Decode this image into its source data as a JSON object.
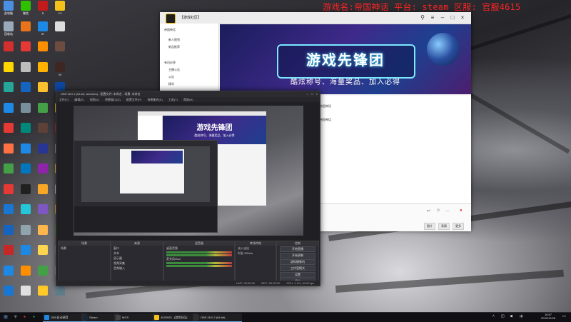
{
  "ticker": "游戏名:帝国神话 平台: steam 区服: 官服4615",
  "colors": {
    "ticker": "#ff2424",
    "accent": "#6aa8e8",
    "obs_bg": "#1f1f24",
    "banner_cyan": "#7be8ff"
  },
  "desktop_icons": [
    {
      "label": "此电脑",
      "color": "#4a90e2"
    },
    {
      "label": "微信",
      "color": "#2dc100"
    },
    {
      "label": "S",
      "color": "#c21b1b"
    },
    {
      "label": "YY",
      "color": "#f4c21b"
    },
    {
      "label": "回收站",
      "color": "#9ab"
    },
    {
      "label": "",
      "color": "#e8731a"
    },
    {
      "label": "IE",
      "color": "#1e88e5"
    },
    {
      "label": "",
      "color": "#ddd"
    },
    {
      "label": "",
      "color": "#d32f2f"
    },
    {
      "label": "",
      "color": "#e53935"
    },
    {
      "label": "",
      "color": "#ff8f00"
    },
    {
      "label": "",
      "color": "#6d4c41"
    },
    {
      "label": "",
      "color": "#ffd600"
    },
    {
      "label": "",
      "color": "#bdbdbd"
    },
    {
      "label": "",
      "color": "#ffb300"
    },
    {
      "label": "M",
      "color": "#3e2723"
    },
    {
      "label": "",
      "color": "#26a69a"
    },
    {
      "label": "",
      "color": "#1565c0"
    },
    {
      "label": "",
      "color": "#fbc02d"
    },
    {
      "label": "",
      "color": "#0d47a1"
    },
    {
      "label": "",
      "color": "#1e88e5"
    },
    {
      "label": "",
      "color": "#78909c"
    },
    {
      "label": "",
      "color": "#43a047"
    },
    {
      "label": "",
      "color": "#ffca28"
    },
    {
      "label": "",
      "color": "#e53935"
    },
    {
      "label": "",
      "color": "#00897b"
    },
    {
      "label": "",
      "color": "#5d4037"
    },
    {
      "label": "",
      "color": "#c62828"
    },
    {
      "label": "",
      "color": "#ff7043"
    },
    {
      "label": "",
      "color": "#1e88e5"
    },
    {
      "label": "",
      "color": "#283593"
    },
    {
      "label": "",
      "color": "#9e9e9e"
    },
    {
      "label": "",
      "color": "#43a047"
    },
    {
      "label": "",
      "color": "#0277bd"
    },
    {
      "label": "",
      "color": "#8e24aa"
    },
    {
      "label": "",
      "color": "#fdd835"
    },
    {
      "label": "",
      "color": "#e53935"
    },
    {
      "label": "",
      "color": "#212121"
    },
    {
      "label": "",
      "color": "#f9a825"
    },
    {
      "label": "",
      "color": "#cfd8dc"
    },
    {
      "label": "",
      "color": "#1976d2"
    },
    {
      "label": "",
      "color": "#26c6da"
    },
    {
      "label": "",
      "color": "#7e57c2"
    },
    {
      "label": "",
      "color": "#fbc02d"
    },
    {
      "label": "",
      "color": "#1565c0"
    },
    {
      "label": "",
      "color": "#90a4ae"
    },
    {
      "label": "",
      "color": "#ffb74d"
    },
    {
      "label": "",
      "color": "#43a047"
    },
    {
      "label": "",
      "color": "#c62828"
    },
    {
      "label": "",
      "color": "#1e88e5"
    },
    {
      "label": "",
      "color": "#ffd54f"
    },
    {
      "label": "",
      "color": "#78909c"
    },
    {
      "label": "",
      "color": "#1e88e5"
    },
    {
      "label": "",
      "color": "#ff8f00"
    },
    {
      "label": "",
      "color": "#43a047"
    },
    {
      "label": "",
      "color": "#9e9e9e"
    },
    {
      "label": "",
      "color": "#1976d2"
    },
    {
      "label": "",
      "color": "#e0e0e0"
    },
    {
      "label": "",
      "color": "#ffca28"
    },
    {
      "label": "",
      "color": "#607d8b"
    }
  ],
  "chat": {
    "title": "【游戏社区】",
    "banner_title": "游戏先锋团",
    "banner_sub": "酷炫称号、海量奖品、加入必得",
    "side_items": [
      "帝国神话",
      "新人报到",
      "新品推荐",
      "有问必答",
      "主播公告",
      "公告",
      "精华"
    ],
    "lines": [
      "帝国神话",
      "帝国神话"
    ],
    "footer_items": [
      "图片",
      "表情",
      "更多"
    ]
  },
  "obs": {
    "title": "OBS 28.0.2 (64-bit, windows) - 配置文件: 未命名 - 场景: 未命名",
    "menu": [
      "文件(F)",
      "编辑(E)",
      "视图(V)",
      "停靠窗口(D)",
      "配置文件(P)",
      "场景集合(S)",
      "工具(T)",
      "帮助(H)"
    ],
    "mini_banner": "游戏先锋团",
    "mini_sub": "酷炫称号、海量奖品、加入必得",
    "docks": {
      "scenes": {
        "title": "场景",
        "items": [
          "场景"
        ]
      },
      "sources": {
        "title": "来源",
        "items": [
          "窗口",
          "文本",
          "显示器",
          "视频采集",
          "音频输入"
        ]
      },
      "mixer": {
        "title": "混音器",
        "items": [
          "桌面音频",
          "麦克风/Aux"
        ]
      },
      "transitions": {
        "title": "转场特效",
        "items": [
          "淡入淡出",
          "时长 300ms"
        ]
      },
      "controls": {
        "title": "控制",
        "buttons": [
          "开始直播",
          "开始录制",
          "虚拟摄像机",
          "工作室模式",
          "设置",
          "退出"
        ]
      }
    },
    "status": [
      "LIVE: 00:00:00",
      "REC: 00:00:00",
      "CPU: 1.1%, 30.00 fps"
    ]
  },
  "taskbar": {
    "apps": [
      {
        "label": "OBS自动调音",
        "color": "#1e88e5"
      },
      {
        "label": "Steam",
        "color": "#1b2838"
      },
      {
        "label": "MGS",
        "color": "#444"
      },
      {
        "label": "4025925 - [游戏社区]",
        "color": "#f4c21b"
      },
      {
        "label": "OBS 28.0.2 (64-bit)",
        "color": "#302e31"
      }
    ],
    "time": "16:57",
    "date": "2023/12/28",
    "lang": "中"
  }
}
